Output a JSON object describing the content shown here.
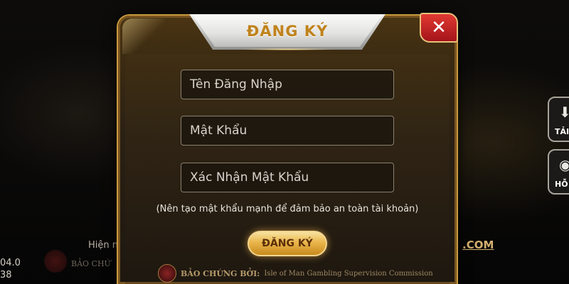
{
  "background": {
    "version_line1": "04.0",
    "version_line2": "38",
    "partial_text": "Hiện na",
    "domain_fragment": ".COM",
    "left_cert_fragment": "BẢO CHỨ",
    "side_buttons": [
      {
        "label": "TẢI",
        "icon": "download-icon"
      },
      {
        "label": "HỖ",
        "icon": "support-icon"
      }
    ]
  },
  "dialog": {
    "title": "ĐĂNG KÝ",
    "close_icon": "close-icon",
    "fields": {
      "username_placeholder": "Tên Đăng Nhập",
      "password_placeholder": "Mật Khẩu",
      "confirm_placeholder": "Xác Nhận Mật Khẩu"
    },
    "hint": "(Nên tạo mật khẩu mạnh để đảm bảo an toàn tài khoản)",
    "submit_label": "ĐĂNG KÝ",
    "certification": {
      "label": "BẢO CHỨNG BỞI:",
      "organization": "Isle of Man Gambling Supervision Commission"
    }
  },
  "colors": {
    "gold_accent": "#c99a3e",
    "title_text": "#c0831c",
    "close_red": "#c9242a",
    "button_gold": "#e9b54a"
  }
}
